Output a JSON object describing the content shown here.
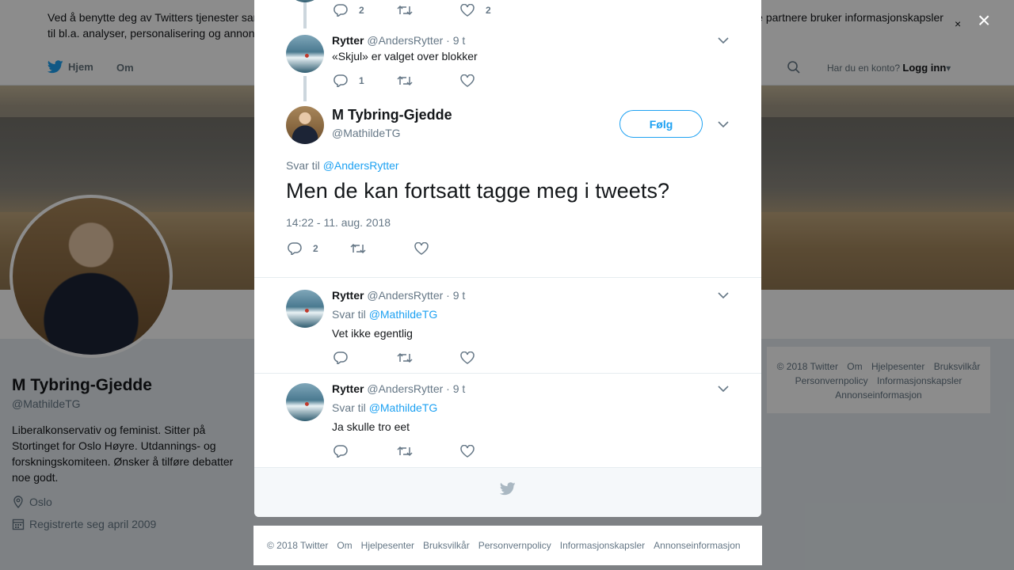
{
  "cookie": {
    "text": "Ved å benytte deg av Twitters tjenester samtykker du til vår bruk av informasjonskapsler og dataoverføring til og fra USA og andre land. Vi og våre partnere bruker informasjonskapsler til bl.a. analyser, personalisering og annonser.",
    "close": "×"
  },
  "nav": {
    "home": "Hjem",
    "about": "Om",
    "login_prompt": "Har du en konto?",
    "login": "Logg inn"
  },
  "profile": {
    "name": "M Tybring-Gjedde",
    "handle": "@MathildeTG",
    "bio": "Liberalkonservativ og feminist. Sitter på Stortinget for Oslo Høyre. Utdannings- og forskningskomiteen. Ønsker å tilføre debatter noe godt.",
    "location": "Oslo",
    "joined": "Registrerte seg april 2009"
  },
  "side_footer": {
    "row1": [
      "© 2018 Twitter",
      "Om",
      "Hjelpesenter",
      "Bruksvilkår"
    ],
    "row2": [
      "Personvernpolicy",
      "Informasjonskapsler"
    ],
    "row3": [
      "Annonseinformasjon"
    ]
  },
  "overlay_close": "×",
  "top_tweet_actions": {
    "replies": "2",
    "likes": "2"
  },
  "tweet1": {
    "name": "Rytter",
    "handle": "@AndersRytter",
    "time": "· 9 t",
    "text": "«Skjul» er valget over blokker",
    "replies": "1"
  },
  "main_tweet": {
    "name": "M Tybring-Gjedde",
    "handle": "@MathildeTG",
    "follow": "Følg",
    "reply_prefix": "Svar til",
    "reply_to": "@AndersRytter",
    "text": "Men de kan fortsatt tagge meg i tweets?",
    "timestamp": "14:22 - 11. aug. 2018",
    "replies": "2"
  },
  "reply1": {
    "name": "Rytter",
    "handle": "@AndersRytter",
    "time": "· 9 t",
    "reply_prefix": "Svar til",
    "reply_to": "@MathildeTG",
    "text": "Vet ikke egentlig"
  },
  "reply2": {
    "name": "Rytter",
    "handle": "@AndersRytter",
    "time": "· 9 t",
    "reply_prefix": "Svar til",
    "reply_to": "@MathildeTG",
    "text": "Ja skulle tro eet"
  },
  "footer": {
    "links": [
      "© 2018 Twitter",
      "Om",
      "Hjelpesenter",
      "Bruksvilkår",
      "Personvernpolicy",
      "Informasjonskapsler",
      "Annonseinformasjon"
    ]
  },
  "colors": {
    "link": "#1da1f2",
    "muted": "#657786",
    "text": "#14171a"
  },
  "icons": [
    "twitter-bird-icon",
    "search-icon",
    "reply-icon",
    "retweet-icon",
    "like-icon",
    "chevron-down-icon",
    "location-icon",
    "calendar-icon",
    "close-icon"
  ]
}
